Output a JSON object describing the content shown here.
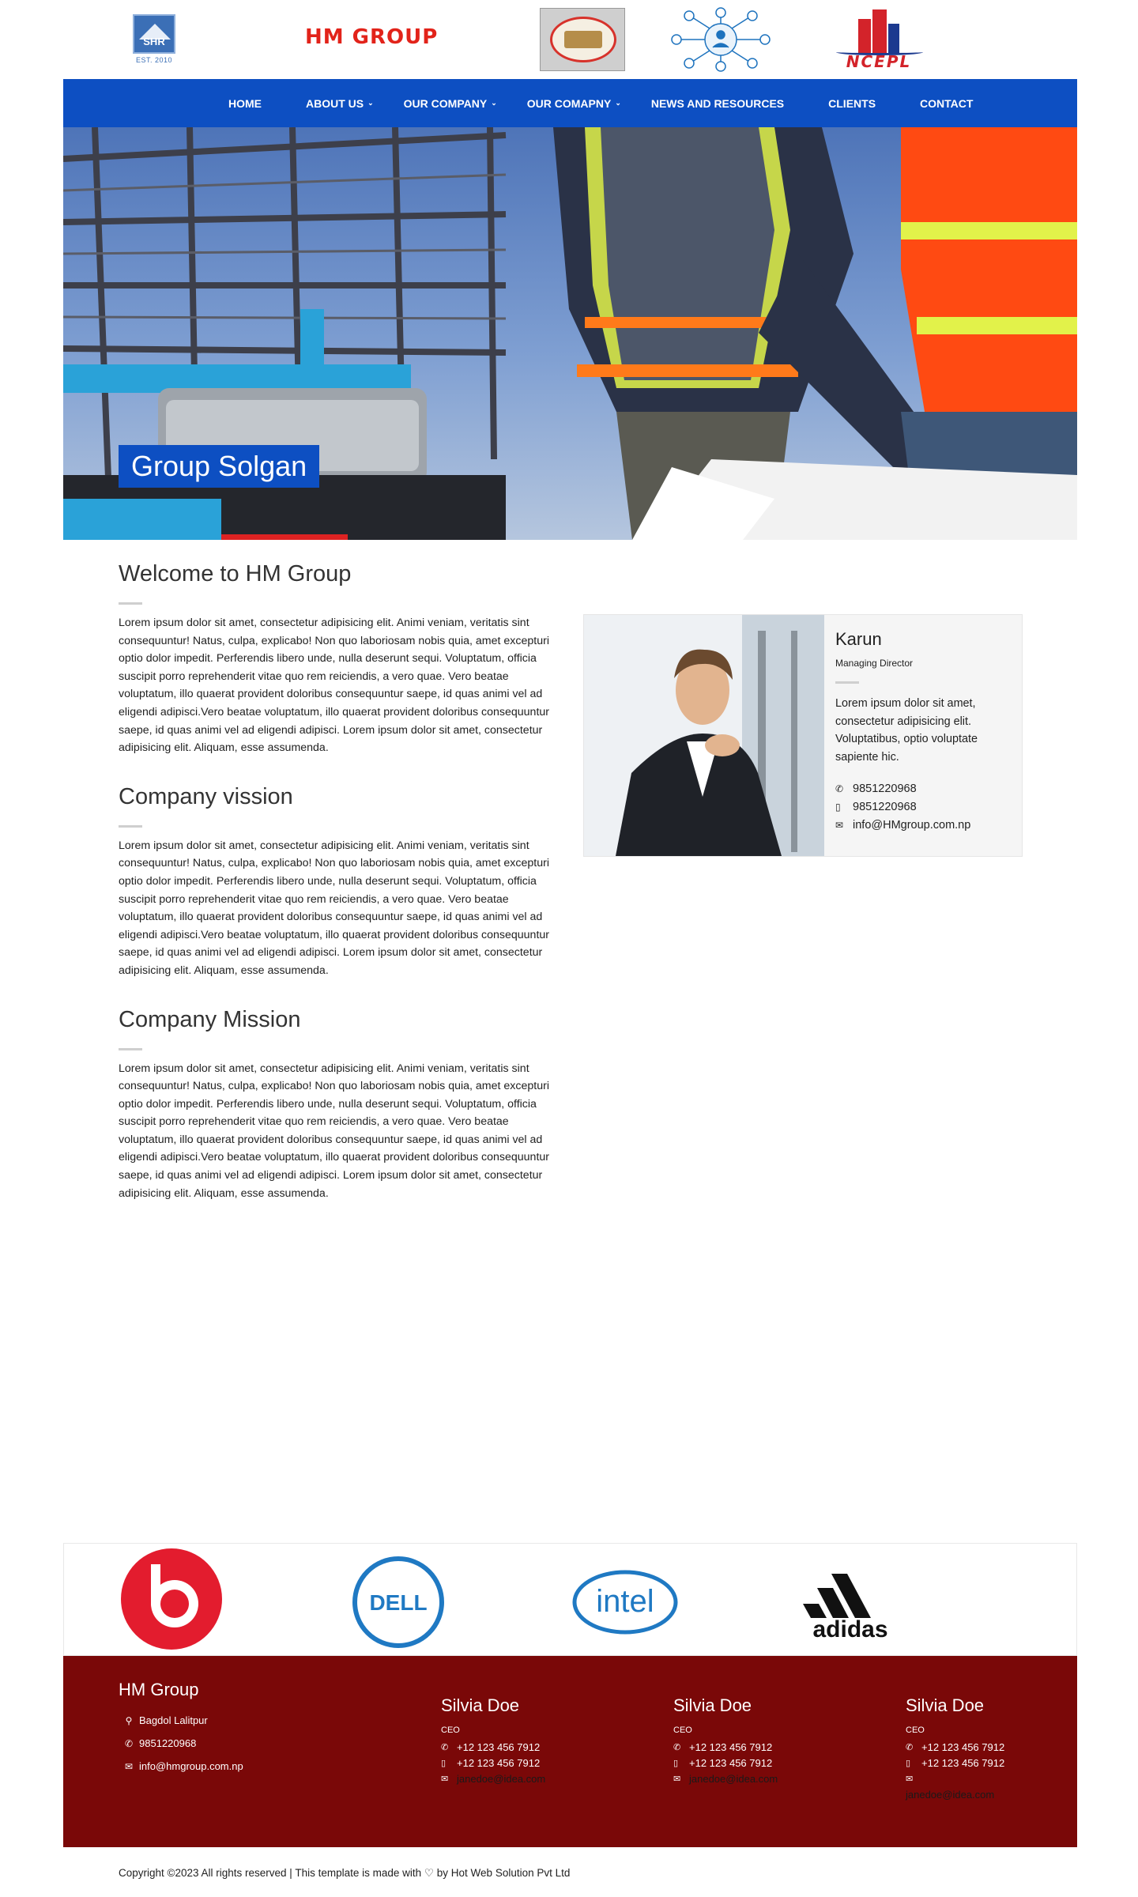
{
  "header": {
    "logos": {
      "shr_abbr": "SHR",
      "shr_est": "EST. 2010",
      "hm_group": "HM GROUP",
      "ncepl": "NCEPL"
    }
  },
  "nav": {
    "items": [
      {
        "label": "HOME",
        "dropdown": false
      },
      {
        "label": "ABOUT US",
        "dropdown": true
      },
      {
        "label": "OUR COMPANY",
        "dropdown": true
      },
      {
        "label": "OUR COMAPNY",
        "dropdown": true
      },
      {
        "label": "NEWS AND RESOURCES",
        "dropdown": false
      },
      {
        "label": "CLIENTS",
        "dropdown": false
      },
      {
        "label": "CONTACT",
        "dropdown": false
      }
    ]
  },
  "hero": {
    "caption": "Group Solgan"
  },
  "sections": [
    {
      "title": "Welcome to HM Group",
      "body": "Lorem ipsum dolor sit amet, consectetur adipisicing elit. Animi veniam, veritatis sint consequuntur! Natus, culpa, explicabo! Non quo laboriosam nobis quia, amet excepturi optio dolor impedit. Perferendis libero unde, nulla deserunt sequi. Voluptatum, officia suscipit porro reprehenderit vitae quo rem reiciendis, a vero quae. Vero beatae voluptatum, illo quaerat provident doloribus consequuntur saepe, id quas animi vel ad eligendi adipisci.Vero beatae voluptatum, illo quaerat provident doloribus consequuntur saepe, id quas animi vel ad eligendi adipisci. Lorem ipsum dolor sit amet, consectetur adipisicing elit. Aliquam, esse assumenda."
    },
    {
      "title": "Company vission",
      "body": "Lorem ipsum dolor sit amet, consectetur adipisicing elit. Animi veniam, veritatis sint consequuntur! Natus, culpa, explicabo! Non quo laboriosam nobis quia, amet excepturi optio dolor impedit. Perferendis libero unde, nulla deserunt sequi. Voluptatum, officia suscipit porro reprehenderit vitae quo rem reiciendis, a vero quae. Vero beatae voluptatum, illo quaerat provident doloribus consequuntur saepe, id quas animi vel ad eligendi adipisci.Vero beatae voluptatum, illo quaerat provident doloribus consequuntur saepe, id quas animi vel ad eligendi adipisci. Lorem ipsum dolor sit amet, consectetur adipisicing elit. Aliquam, esse assumenda."
    },
    {
      "title": "Company Mission",
      "body": "Lorem ipsum dolor sit amet, consectetur adipisicing elit. Animi veniam, veritatis sint consequuntur! Natus, culpa, explicabo! Non quo laboriosam nobis quia, amet excepturi optio dolor impedit. Perferendis libero unde, nulla deserunt sequi. Voluptatum, officia suscipit porro reprehenderit vitae quo rem reiciendis, a vero quae. Vero beatae voluptatum, illo quaerat provident doloribus consequuntur saepe, id quas animi vel ad eligendi adipisci.Vero beatae voluptatum, illo quaerat provident doloribus consequuntur saepe, id quas animi vel ad eligendi adipisci. Lorem ipsum dolor sit amet, consectetur adipisicing elit. Aliquam, esse assumenda."
    }
  ],
  "profile": {
    "name": "Karun",
    "role": "Managing Director",
    "bio": "Lorem ipsum dolor sit amet, consectetur adipisicing elit. Voluptatibus, optio voluptate sapiente hic.",
    "phone": "9851220968",
    "mobile": "9851220968",
    "email": "info@HMgroup.com.np"
  },
  "partners": {
    "intel": "intel",
    "adidas": "adidas",
    "dell": "DELL"
  },
  "footer": {
    "company": {
      "name": "HM Group",
      "address": "Bagdol Lalitpur",
      "phone": "9851220968",
      "email": "info@hmgroup.com.np"
    },
    "people": [
      {
        "name": "Silvia Doe",
        "role": "CEO",
        "phone": "+12 123 456 7912",
        "mobile": "+12 123 456 7912",
        "email": "janedoe@idea.com"
      },
      {
        "name": "Silvia Doe",
        "role": "CEO",
        "phone": "+12 123 456 7912",
        "mobile": "+12 123 456 7912",
        "email": "janedoe@idea.com"
      },
      {
        "name": "Silvia Doe",
        "role": "CEO",
        "phone": "+12 123 456 7912",
        "mobile": "+12 123 456 7912",
        "email": "janedoe@idea.com"
      }
    ]
  },
  "copyright": {
    "before": "Copyright ©2023 All rights reserved | This template is made with",
    "after": "by Hot Web Solution Pvt Ltd"
  },
  "colors": {
    "nav_bg": "#0d4fc2",
    "footer_bg": "#7a0808",
    "hm_red": "#e2231a"
  },
  "icons": [
    "phone-icon",
    "mobile-icon",
    "envelope-icon",
    "map-marker-icon",
    "heart-icon",
    "chevron-down-icon"
  ]
}
